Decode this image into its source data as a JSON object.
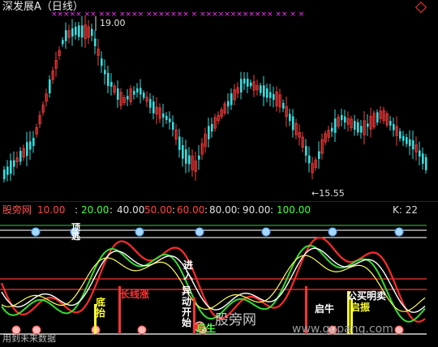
{
  "price_pane": {
    "title": "深发展A（日线）",
    "signal_marks": "×××××  ××  ×××                ××××  ×××××××  ×  ××××××××××××  ××  ×  ×",
    "high_label": "19.00",
    "low_label": "←15.55"
  },
  "indicator_pane": {
    "name": "股旁网",
    "levels": [
      {
        "text": "10.00",
        "color": "#ff4444"
      },
      {
        "text": "20.00",
        "color": "#44ff44"
      },
      {
        "text": "40.00",
        "color": "#e0e0e0"
      },
      {
        "text": "50.00",
        "color": "#ff4444"
      },
      {
        "text": "60.00",
        "color": "#ff4444"
      },
      {
        "text": "80.00",
        "color": "#e0e0e0"
      },
      {
        "text": "90.00",
        "color": "#e0e0e0"
      },
      {
        "text": "100.00",
        "color": "#44ff44"
      }
    ],
    "k_label": "K: 22",
    "signals": {
      "top_escape": "顶逃",
      "enter": "进入",
      "abnormal_start": "异动开始",
      "bottom_lift": "底抬",
      "long_rise": "长线涨",
      "start": "启生",
      "bull_start": "启牛",
      "open_buy": "公买明卖",
      "start_shake": "启振"
    },
    "watermark": "股旁网",
    "url": "www.gupang.com",
    "footer": "用到未来数据"
  }
}
